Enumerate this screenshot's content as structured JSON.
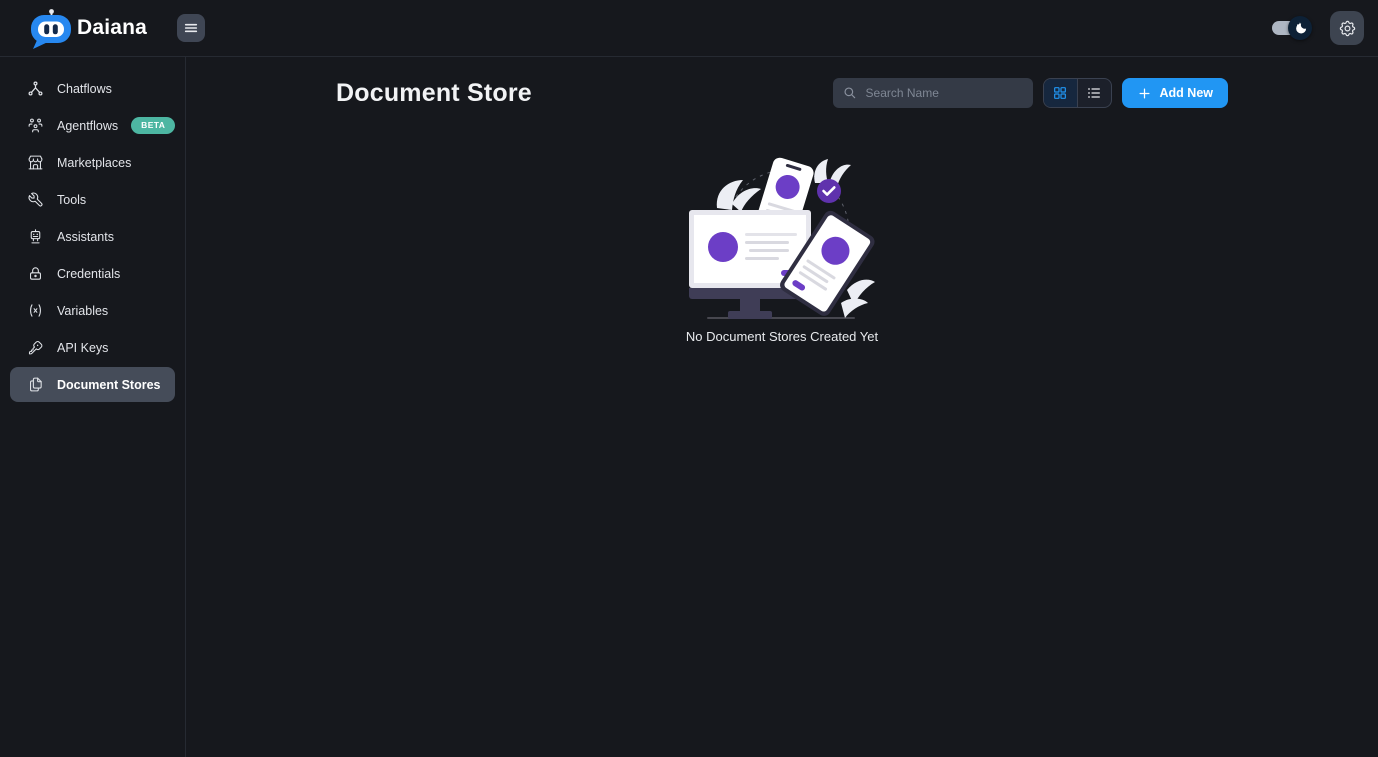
{
  "app": {
    "brand": "Daiana"
  },
  "topbar": {
    "menu_icon": "hamburger-menu-icon",
    "dark_mode_toggle": {
      "state": "on",
      "thumb_icon": "moon-icon"
    },
    "settings_icon": "gear-icon"
  },
  "sidebar": {
    "items": [
      {
        "label": "Chatflows",
        "icon": "hierarchy-icon",
        "active": false
      },
      {
        "label": "Agentflows",
        "icon": "users-group-icon",
        "active": false,
        "badge": "BETA"
      },
      {
        "label": "Marketplaces",
        "icon": "store-icon",
        "active": false
      },
      {
        "label": "Tools",
        "icon": "wrench-icon",
        "active": false
      },
      {
        "label": "Assistants",
        "icon": "robot-icon",
        "active": false
      },
      {
        "label": "Credentials",
        "icon": "lock-icon",
        "active": false
      },
      {
        "label": "Variables",
        "icon": "variable-icon",
        "active": false
      },
      {
        "label": "API Keys",
        "icon": "key-icon",
        "active": false
      },
      {
        "label": "Document Stores",
        "icon": "files-icon",
        "active": true
      }
    ]
  },
  "main": {
    "title": "Document Store",
    "search": {
      "placeholder": "Search Name",
      "value": "",
      "icon": "search-icon"
    },
    "view_toggle": {
      "options": [
        {
          "name": "grid-view",
          "icon": "grid-view-icon",
          "active": true
        },
        {
          "name": "list-view",
          "icon": "list-view-icon",
          "active": false
        }
      ]
    },
    "add_button": {
      "label": "Add New",
      "icon": "plus-icon"
    },
    "empty_state": {
      "message": "No Document Stores Created Yet",
      "illustration": "document-store-empty-illustration"
    }
  },
  "colors": {
    "accent_blue": "#2196f3",
    "beta_badge_teal": "#4db6a2",
    "illustration_purple": "#6c3ec6",
    "background": "#16181d",
    "sidebar_active_bg": "#454c59",
    "toggle_thumb_navy": "#0d2136"
  }
}
